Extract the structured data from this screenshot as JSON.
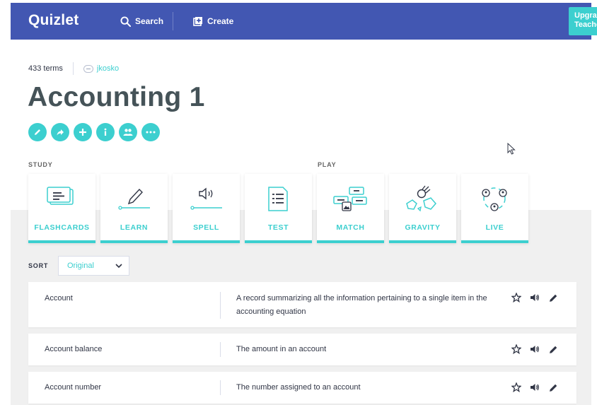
{
  "header": {
    "logo": "Quizlet",
    "search_label": "Search",
    "create_label": "Create",
    "upgrade_label": "Upgrade",
    "upgrade_sub": "Teacher"
  },
  "set": {
    "term_count": "433 terms",
    "author": "jkosko",
    "title": "Accounting 1"
  },
  "actions": [
    "pencil-icon",
    "share-icon",
    "plus-icon",
    "info-icon",
    "people-icon",
    "more-icon"
  ],
  "sections": {
    "study": "STUDY",
    "play": "PLAY"
  },
  "modes": [
    {
      "label": "FLASHCARDS",
      "icon": "flashcards-icon"
    },
    {
      "label": "LEARN",
      "icon": "learn-icon"
    },
    {
      "label": "SPELL",
      "icon": "spell-icon"
    },
    {
      "label": "TEST",
      "icon": "test-icon"
    },
    {
      "label": "MATCH",
      "icon": "match-icon"
    },
    {
      "label": "GRAVITY",
      "icon": "gravity-icon"
    },
    {
      "label": "LIVE",
      "icon": "live-icon"
    }
  ],
  "sort": {
    "label": "SORT",
    "value": "Original"
  },
  "terms": [
    {
      "term": "Account",
      "definition": "A record summarizing all the information pertaining to a single item in the accounting equation"
    },
    {
      "term": "Account balance",
      "definition": "The amount in an account"
    },
    {
      "term": "Account number",
      "definition": "The number assigned to an account"
    }
  ],
  "colors": {
    "brand": "#4257b2",
    "accent": "#3ccfcf",
    "title": "#455358"
  }
}
